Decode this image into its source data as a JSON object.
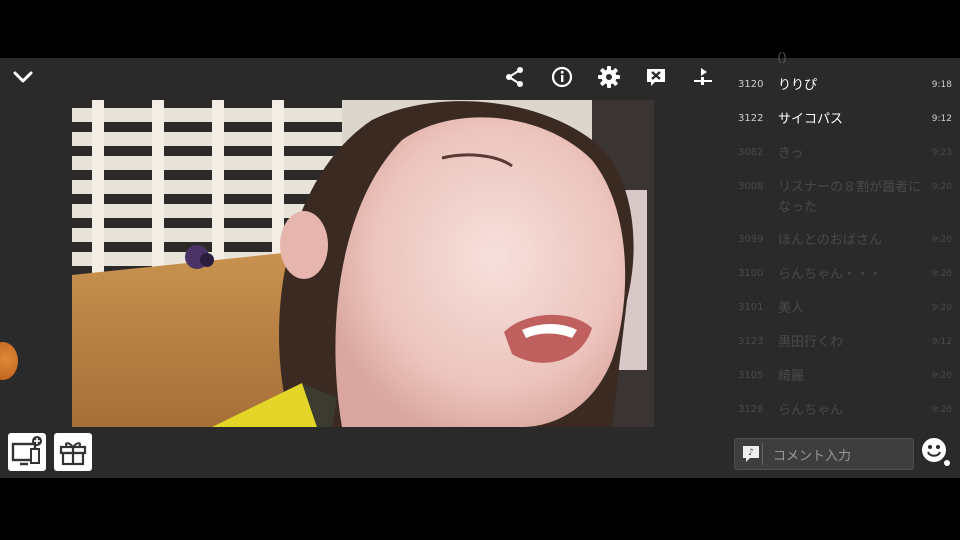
{
  "icons": {
    "collapse": "chevron-down-icon",
    "share": "share-icon",
    "info": "info-icon",
    "settings": "gear-icon",
    "close_comments": "close-box-icon",
    "playback_control": "play-slider-icon",
    "screen_add": "screen-add-icon",
    "gift": "gift-icon",
    "comment": "comment-bubble-icon",
    "emoji": "smiley-icon"
  },
  "colors": {
    "panel_bg": "#2a2a2a",
    "comment_text": "#ffffff",
    "comment_dim": "#4a4a4a",
    "orb": "#d27530"
  },
  "comments": [
    {
      "num": "3120",
      "text": "りりぴ",
      "time": "9:18",
      "dim": false
    },
    {
      "num": "3122",
      "text": "サイコパス",
      "time": "9:12",
      "dim": false
    },
    {
      "num": "3082",
      "text": "きっ",
      "time": "9:23",
      "dim": true
    },
    {
      "num": "3008",
      "text": "リスナーの８割が醤者になった",
      "time": "9:20",
      "dim": true
    },
    {
      "num": "3099",
      "text": "ほんとのおばさん",
      "time": "9:20",
      "dim": true
    },
    {
      "num": "3100",
      "text": "らんちゃん・・・",
      "time": "9:20",
      "dim": true
    },
    {
      "num": "3101",
      "text": "美人",
      "time": "9:20",
      "dim": true
    },
    {
      "num": "3123",
      "text": "黒田行くわ",
      "time": "9:12",
      "dim": true
    },
    {
      "num": "3105",
      "text": "綺麗",
      "time": "9:20",
      "dim": true
    },
    {
      "num": "3128",
      "text": "らんちゃん",
      "time": "9:20",
      "dim": true
    }
  ],
  "comment_input": {
    "placeholder": "コメント入力"
  }
}
